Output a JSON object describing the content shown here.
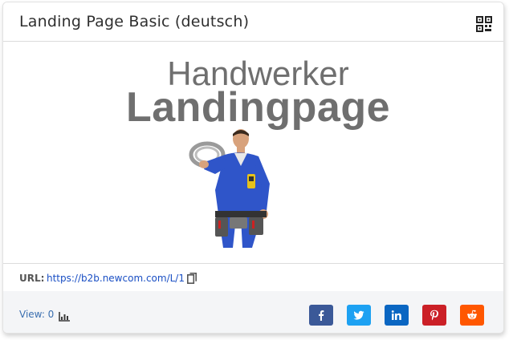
{
  "card": {
    "title": "Landing Page Basic (deutsch)",
    "qr_icon": "qr-code-icon"
  },
  "preview": {
    "line1": "Handwerker",
    "line2": "Landingpage",
    "image": "craftsman-worker-image"
  },
  "url": {
    "label": "URL:",
    "value": "https://b2b.newcom.com/L/1",
    "copy_icon": "copy-icon"
  },
  "footer": {
    "views_label": "View: 0",
    "chart_icon": "bar-chart-icon",
    "share": [
      {
        "network": "facebook",
        "icon": "facebook-icon",
        "color": "#3b5998"
      },
      {
        "network": "twitter",
        "icon": "twitter-icon",
        "color": "#1da1f2"
      },
      {
        "network": "linkedin",
        "icon": "linkedin-icon",
        "color": "#0a66c2"
      },
      {
        "network": "pinterest",
        "icon": "pinterest-icon",
        "color": "#cb2027"
      },
      {
        "network": "reddit",
        "icon": "reddit-icon",
        "color": "#ff5700"
      }
    ]
  }
}
